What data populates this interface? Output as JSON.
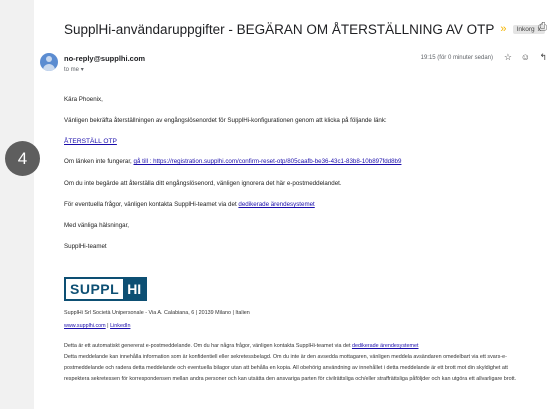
{
  "header": {
    "subject": "SupplHi-användaruppgifter - BEGÄRAN OM ÅTERSTÄLLNING AV OTP",
    "important_marker": "»",
    "label": "Inkorg",
    "label_close": "x"
  },
  "message": {
    "sender": "no-reply@supplhi.com",
    "to": "to me",
    "to_caret": "▾",
    "time": "19:15 (för 0 minuter sedan)"
  },
  "body": {
    "greeting": "Kära Phoenix,",
    "intro": "Vänligen bekräfta återställningen av engångslösenordet för SupplHi-konfigurationen genom att klicka på följande länk:",
    "reset_link": "ÅTERSTÄLL OTP",
    "fallback_prefix": "Om länken inte fungerar,",
    "fallback_link": "gå till : https://registration.supplhi.com/confirm-reset-otp/805caafb-be36-43c1-83b8-10b897fdd8b9",
    "ignore": "Om du inte begärde att återställa ditt engångslösenord, vänligen ignorera det här e-postmeddelandet.",
    "questions_prefix": "För eventuella frågor, vänligen kontakta SupplHi-teamet via det",
    "questions_link": "dedikerade ärendesystemet",
    "regards": "Med vänliga hälsningar,",
    "team": "SupplHi-teamet"
  },
  "signature": {
    "logo_left": "SUPPL",
    "logo_right": "HI",
    "address": "SupplHi Srl Società Unipersonale - Via A. Calabiana, 6 | 20139 Milano | Italien",
    "website": "www.supplhi.com",
    "separator": " | ",
    "linkedin": "LinkedIn",
    "auto_prefix": "Detta är ett automatiskt genererat e-postmeddelande. Om du har några frågor, vänligen kontakta SupplHi-teamet via det",
    "auto_link": "dedikerade ärendesystemet",
    "confidential_1": "Detta meddelande kan innehålla information som är konfidentiell eller sekretessbelagd. Om du inte är den avsedda mottagaren, vänligen meddela avsändaren omedelbart via ett svars-e-",
    "confidential_2": "postmeddelande och radera detta meddelande och eventuella bilagor utan att behålla en kopia. All obehörig användning av innehållet i detta meddelande är ett brott mot din skyldighet att",
    "confidential_3": "respektera sekretessen för korrespondensen mellan andra personer och kan utsätta den ansvariga parten för civilrättsliga och/eller straffrättsliga påföljder och kan utgöra ett allvarligare brott."
  },
  "overlay": {
    "step_badge": "4"
  },
  "icons": {
    "print": "print-icon",
    "star": "star-icon",
    "emoji": "emoji-icon",
    "reply": "reply-icon"
  }
}
